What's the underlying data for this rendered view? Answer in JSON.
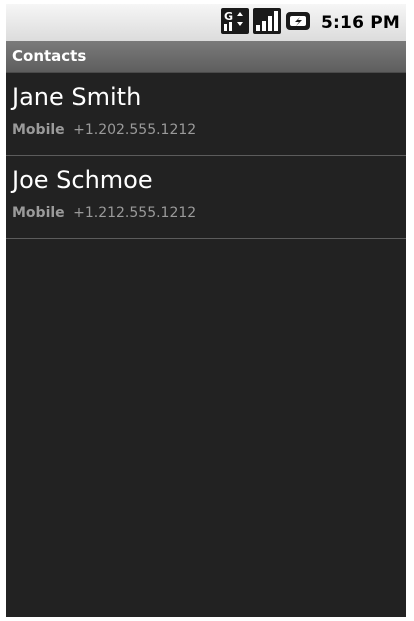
{
  "status_bar": {
    "icons": [
      "data-3g-icon",
      "signal-strength-icon",
      "battery-charging-icon"
    ],
    "time": "5:16 PM"
  },
  "title_bar": {
    "title": "Contacts"
  },
  "contacts": [
    {
      "name": "Jane Smith",
      "phone_type": "Mobile",
      "phone_number": "+1.202.555.1212"
    },
    {
      "name": "Joe Schmoe",
      "phone_type": "Mobile",
      "phone_number": "+1.212.555.1212"
    }
  ],
  "colors": {
    "background": "#222222",
    "status_bar": "#e8e8e8",
    "title_bar": "#6b6b6b",
    "primary_text": "#ffffff",
    "secondary_text": "#9a9a9a"
  }
}
